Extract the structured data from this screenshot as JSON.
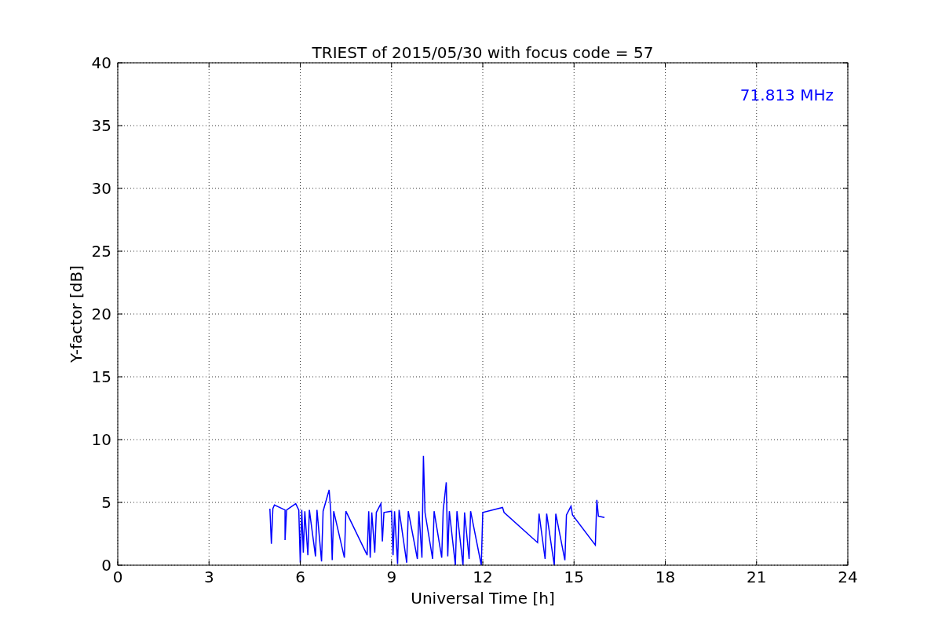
{
  "chart_data": {
    "type": "line",
    "title": "TRIEST of 2015/05/30 with focus code = 57",
    "xlabel": "Universal Time [h]",
    "ylabel": "Y-factor [dB]",
    "xlim": [
      0,
      24
    ],
    "ylim": [
      0,
      40
    ],
    "xticks": [
      0,
      3,
      6,
      9,
      12,
      15,
      18,
      21,
      24
    ],
    "yticks": [
      0,
      5,
      10,
      15,
      20,
      25,
      30,
      35,
      40
    ],
    "x": [
      5.0,
      5.05,
      5.1,
      5.15,
      5.5,
      5.5,
      5.55,
      5.85,
      5.95,
      6.0,
      6.05,
      6.1,
      6.15,
      6.25,
      6.3,
      6.5,
      6.55,
      6.7,
      6.75,
      6.95,
      7.0,
      7.05,
      7.1,
      7.45,
      7.5,
      8.2,
      8.25,
      8.3,
      8.35,
      8.45,
      8.5,
      8.65,
      8.7,
      8.75,
      9.0,
      9.05,
      9.1,
      9.2,
      9.25,
      9.5,
      9.55,
      9.85,
      9.9,
      10.0,
      10.05,
      10.1,
      10.35,
      10.4,
      10.65,
      10.7,
      10.8,
      10.85,
      10.9,
      11.1,
      11.15,
      11.35,
      11.4,
      11.55,
      11.6,
      11.95,
      12.0,
      12.65,
      12.7,
      13.8,
      13.85,
      14.05,
      14.1,
      14.35,
      14.4,
      14.7,
      14.75,
      14.9,
      14.95,
      15.7,
      15.75,
      15.8,
      16.0
    ],
    "grid": true,
    "series": [
      {
        "color": "#0000ff",
        "values": [
          4.5,
          1.7,
          4.5,
          4.8,
          4.4,
          2.0,
          4.4,
          4.9,
          4.4,
          0.2,
          4.4,
          1.0,
          4.3,
          0.8,
          4.4,
          0.7,
          4.4,
          0.3,
          4.3,
          6.0,
          4.3,
          0.4,
          4.3,
          0.6,
          4.3,
          0.8,
          4.3,
          0.6,
          4.2,
          1.0,
          4.2,
          4.9,
          1.9,
          4.2,
          4.3,
          0.8,
          4.3,
          0.1,
          4.4,
          0.2,
          4.3,
          0.5,
          4.3,
          0.6,
          8.7,
          4.2,
          0.5,
          4.3,
          0.6,
          4.4,
          6.6,
          0.7,
          4.3,
          0.0,
          4.3,
          0.0,
          4.2,
          0.5,
          4.3,
          0.0,
          4.2,
          4.6,
          4.2,
          1.8,
          4.1,
          0.5,
          4.1,
          0.0,
          4.1,
          0.4,
          4.0,
          4.7,
          4.0,
          1.6,
          5.2,
          3.9,
          3.8
        ]
      }
    ],
    "annotations": [
      {
        "text": "71.813 MHz"
      }
    ]
  }
}
